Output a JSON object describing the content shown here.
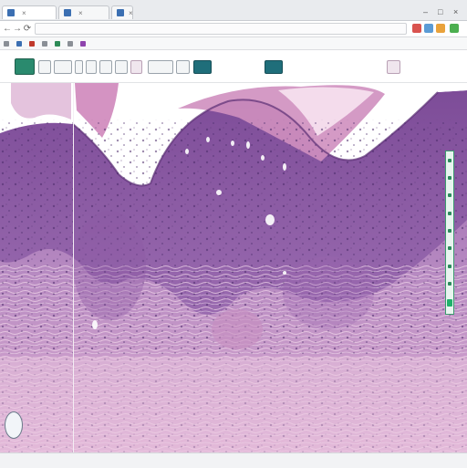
{
  "browser": {
    "tabs": [
      {
        "label": "",
        "close": "×"
      },
      {
        "label": "",
        "close": "×"
      },
      {
        "label": "",
        "close": "×"
      }
    ],
    "window_controls": [
      "–",
      "□",
      "×"
    ],
    "nav": {
      "back": "←",
      "forward": "→",
      "reload": "⟳"
    },
    "url": "",
    "bookmarks": [
      "",
      "",
      "",
      "",
      "",
      "",
      ""
    ]
  },
  "viewer": {
    "compass_label": "",
    "stain_colors": {
      "epidermis": "#8d5ba3",
      "dermis": "#b27fb8",
      "collagen": "#e7c3dc",
      "stratum_corneum": "#cf8fbf"
    }
  }
}
